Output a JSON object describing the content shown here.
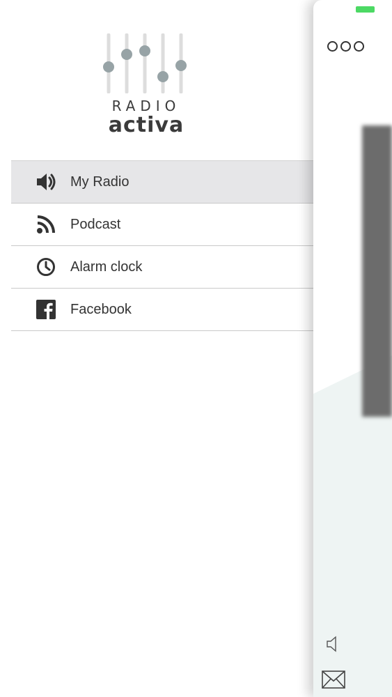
{
  "logo": {
    "top_text": "RADIO",
    "bottom_text": "activa",
    "icon": "equalizer-sliders-icon"
  },
  "menu": {
    "items": [
      {
        "label": "My Radio",
        "icon": "speaker-icon",
        "active": true
      },
      {
        "label": "Podcast",
        "icon": "rss-icon",
        "active": false
      },
      {
        "label": "Alarm clock",
        "icon": "clock-icon",
        "active": false
      },
      {
        "label": "Facebook",
        "icon": "facebook-icon",
        "active": false
      }
    ]
  },
  "panel": {
    "menu_icon": "three-dots-icon",
    "volume_icon": "speaker-outline-icon",
    "mail_icon": "envelope-icon"
  },
  "colors": {
    "active_bg": "#e6e6e8",
    "battery": "#4cd964",
    "logo_gray": "#97a3a6",
    "text": "#333333"
  }
}
